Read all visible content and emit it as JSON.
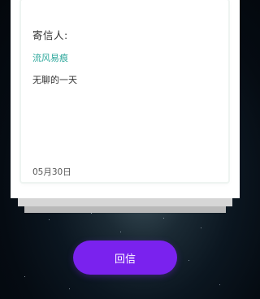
{
  "letter": {
    "sender_label": "寄信人:",
    "sender_name": "流风易痕",
    "message": "无聊的一天",
    "date": "05月30日"
  },
  "actions": {
    "reply_label": "回信"
  },
  "colors": {
    "accent": "#7a22ee",
    "sender_name": "#2aa69a",
    "background": "#0b1620"
  }
}
